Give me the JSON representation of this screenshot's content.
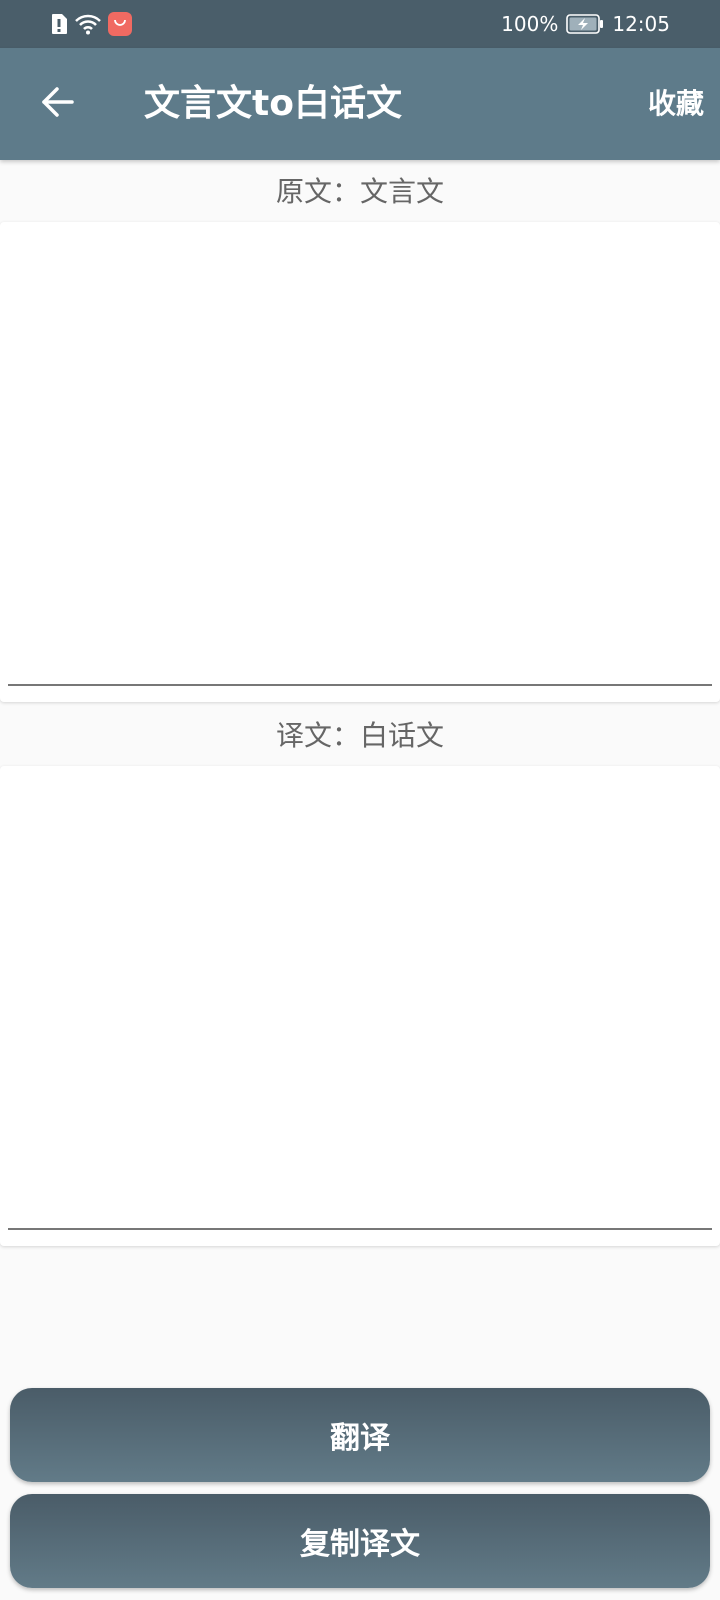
{
  "status_bar": {
    "battery": "100%",
    "time": "12:05",
    "icons": [
      "alert-icon",
      "wifi-icon",
      "app-store-icon",
      "battery-charging-icon"
    ],
    "colors": {
      "app_icon": "#f06a62"
    }
  },
  "app_bar": {
    "title": "文言文to白话文",
    "favorite_label": "收藏",
    "back_icon": "arrow-left-icon",
    "color": "#5e7b8a"
  },
  "source": {
    "label": "原文：文言文",
    "value": ""
  },
  "target": {
    "label": "译文：白话文",
    "value": ""
  },
  "buttons": {
    "translate_label": "翻译",
    "copy_label": "复制译文"
  }
}
